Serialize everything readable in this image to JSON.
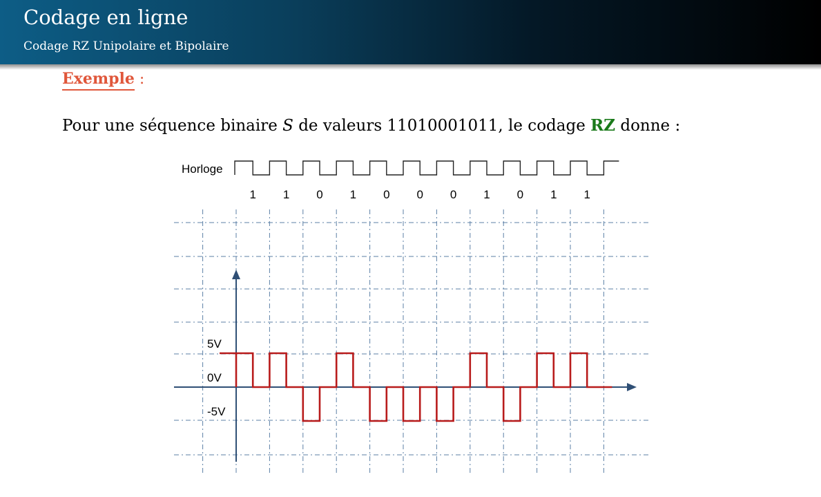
{
  "header": {
    "title": "Codage en ligne",
    "subtitle": "Codage RZ Unipolaire et Bipolaire"
  },
  "example": {
    "label": "Exemple",
    "suffix": " :"
  },
  "sentence": {
    "part1": "Pour une séquence binaire ",
    "variable": "S",
    "part2": " de valeurs 11010001011, le codage ",
    "code": "RZ",
    "part3": " donne :"
  },
  "chart_data": {
    "type": "line",
    "clock_label": "Horloge",
    "bits": [
      "1",
      "1",
      "0",
      "1",
      "0",
      "0",
      "0",
      "1",
      "0",
      "1",
      "1"
    ],
    "y_tick_labels": [
      "5V",
      "0V",
      "-5V"
    ],
    "y_values": [
      5,
      0,
      -5
    ],
    "signal_levels": [
      5,
      5,
      -5,
      5,
      -5,
      -5,
      -5,
      5,
      -5,
      5,
      5
    ],
    "return_to_zero": true,
    "grid": true,
    "colors": {
      "signal": "#b81b1b",
      "axis": "#2f4f75",
      "grid": "#5b7fa6",
      "clock": "#222222"
    }
  }
}
